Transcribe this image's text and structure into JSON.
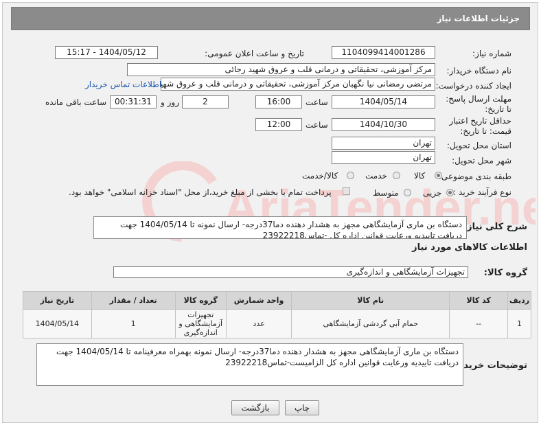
{
  "header": {
    "title": "جزئیات اطلاعات نیاز"
  },
  "fields": {
    "need_number_label": "شماره نیاز:",
    "need_number": "1104099414001286",
    "announce_label": "تاریخ و ساعت اعلان عمومی:",
    "announce_value": "1404/05/12 - 15:17",
    "buyer_org_label": "نام دستگاه خریدار:",
    "buyer_org": "مرکز آموزشی، تحقیقاتی و درمانی قلب و عروق شهید رجائی",
    "requester_label": "ایجاد کننده درخواست:",
    "requester": "مرتضی رمضانی نیا نگهبان مرکز آموزشی، تحقیقاتی و درمانی قلب و عروق شهید",
    "contact_link": "اطلاعات تماس خریدار",
    "deadline_label": "مهلت ارسال پاسخ: تا تاریخ:",
    "deadline_date": "1404/05/14",
    "time_label": "ساعت",
    "deadline_time": "16:00",
    "days_value": "2",
    "days_label": "روز و",
    "remaining_time": "00:31:31",
    "remaining_label": "ساعت باقی مانده",
    "validity_label": "حداقل تاریخ اعتبار قیمت: تا تاریخ:",
    "validity_date": "1404/10/30",
    "validity_time": "12:00",
    "province_label": "استان محل تحویل:",
    "province": "تهران",
    "city_label": "شهر محل تحویل:",
    "city": "تهران",
    "category_label": "طبقه بندی موضوعی:",
    "category_options": [
      "کالا",
      "خدمت",
      "کالا/خدمت"
    ],
    "process_label": "نوع فرآیند خرید :",
    "process_options": [
      "جزیی",
      "متوسط"
    ],
    "payment_note": "پرداخت تمام یا بخشی از مبلغ خرید،از محل \"اسناد خزانه اسلامی\" خواهد بود.",
    "summary_label": "شرح کلی نیاز:",
    "summary": "دستگاه بن ماری آزمایشگاهی مجهز به هشدار دهنده دما37درجه- ارسال نمونه تا 1404/05/14 جهت دریافت تاییدیه ورعایت قوانین اداره کل -تماس23922218"
  },
  "goods": {
    "section_title": "اطلاعات کالاهای مورد نیاز",
    "group_label": "گروه کالا:",
    "group_value": "تجهیزات آزمایشگاهی و اندازه‌گیری",
    "columns": [
      "ردیف",
      "کد کالا",
      "نام کالا",
      "واحد شمارش",
      "گروه کالا",
      "تعداد / مقدار",
      "تاریخ نیاز"
    ],
    "rows": [
      [
        "1",
        "--",
        "حمام آبی گردشی آزمایشگاهی",
        "عدد",
        "تجهیزات آزمایشگاهی و اندازه‌گیری",
        "1",
        "1404/05/14"
      ]
    ]
  },
  "buyer_notes": {
    "label": "توضیحات خریدار:",
    "text": "دستگاه بن ماری آزمایشگاهی مجهز به هشدار دهنده دما37درجه- ارسال نمونه بهمراه معرفینامه تا 1404/05/14 جهت دریافت تاییدیه ورعایت قوانین اداره کل الزامیست-تماس23922218"
  },
  "buttons": {
    "print": "چاپ",
    "back": "بازگشت"
  },
  "watermark": {
    "text": "AriaTender.neT"
  },
  "colors": {
    "header_bg": "#8b8b8b",
    "link": "#1a56b0",
    "watermark": "#f2c9c9"
  }
}
